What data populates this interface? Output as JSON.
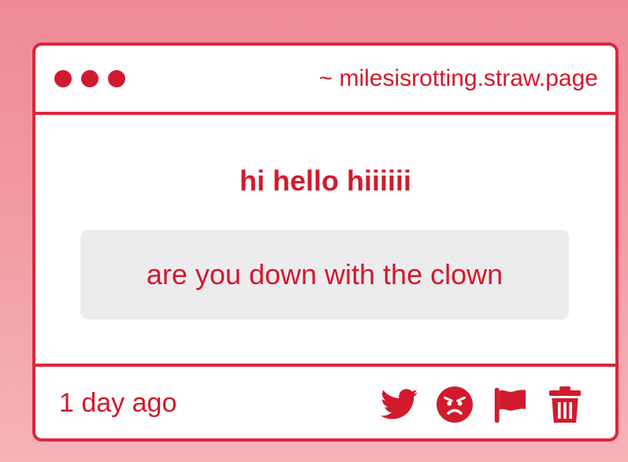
{
  "window": {
    "url": "~ milesisrotting.straw.page"
  },
  "post": {
    "headline": "hi hello hiiiiii",
    "message": "are you down with the clown",
    "timestamp": "1 day ago"
  },
  "actions": [
    {
      "icon": "twitter-icon"
    },
    {
      "icon": "angry-face-icon"
    },
    {
      "icon": "flag-icon"
    },
    {
      "icon": "trash-icon"
    }
  ],
  "colors": {
    "accent": "#d21a2e",
    "border": "#d9283e",
    "message_bg": "#ececee",
    "background_top": "#ee8a94",
    "background_bottom": "#f6b3b9"
  }
}
